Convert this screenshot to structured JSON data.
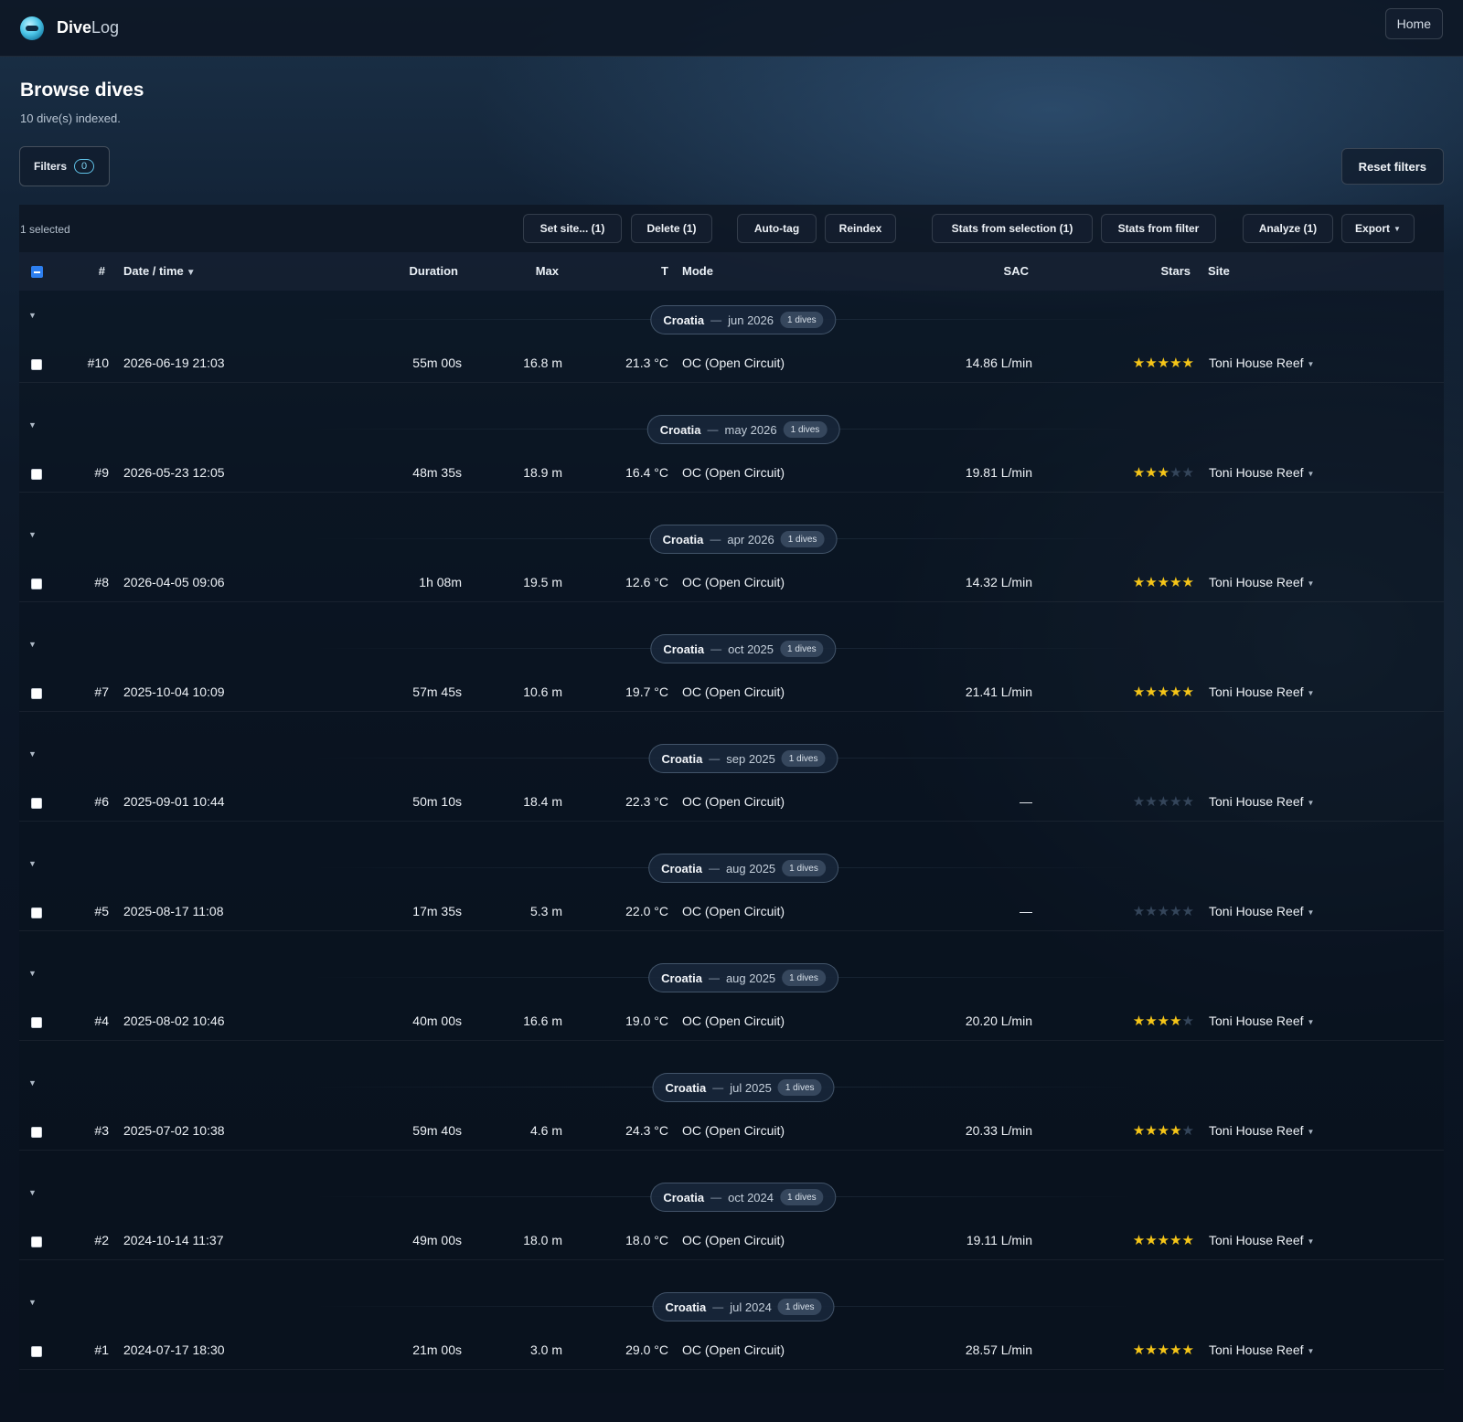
{
  "app": {
    "brand_bold": "Dive",
    "brand_light": "Log",
    "home_label": "Home"
  },
  "page": {
    "title": "Browse dives",
    "subtitle": "10 dive(s) indexed."
  },
  "filters": {
    "label": "Filters",
    "count": "0",
    "reset_label": "Reset filters"
  },
  "actions": {
    "selected_text": "1 selected",
    "set_site": "Set site... (1)",
    "delete": "Delete (1)",
    "auto_tag": "Auto-tag",
    "reindex": "Reindex",
    "stats_selection": "Stats from selection (1)",
    "stats_filter": "Stats from filter",
    "analyze": "Analyze (1)",
    "export": "Export"
  },
  "columns": {
    "num": "#",
    "date": "Date / time",
    "duration": "Duration",
    "max": "Max",
    "temp": "T",
    "mode": "Mode",
    "sac": "SAC",
    "stars": "Stars",
    "site": "Site"
  },
  "colors": {
    "accent": "#2d7ff0",
    "star_on": "#f5c518",
    "star_off": "#34455a",
    "background": "#0b1524"
  },
  "groups": [
    {
      "country": "Croatia",
      "sep": "—",
      "month": "jun 2026",
      "count": "1 dives",
      "dive": {
        "num": "#10",
        "date": "2026-06-19 21:03",
        "duration": "55m 00s",
        "max": "16.8 m",
        "temp": "21.3 °C",
        "mode": "OC (Open Circuit)",
        "sac": "14.86 L/min",
        "stars": 5,
        "site": "Toni House Reef"
      }
    },
    {
      "country": "Croatia",
      "sep": "—",
      "month": "may 2026",
      "count": "1 dives",
      "dive": {
        "num": "#9",
        "date": "2026-05-23 12:05",
        "duration": "48m 35s",
        "max": "18.9 m",
        "temp": "16.4 °C",
        "mode": "OC (Open Circuit)",
        "sac": "19.81 L/min",
        "stars": 3,
        "site": "Toni House Reef"
      }
    },
    {
      "country": "Croatia",
      "sep": "—",
      "month": "apr 2026",
      "count": "1 dives",
      "dive": {
        "num": "#8",
        "date": "2026-04-05 09:06",
        "duration": "1h 08m",
        "max": "19.5 m",
        "temp": "12.6 °C",
        "mode": "OC (Open Circuit)",
        "sac": "14.32 L/min",
        "stars": 5,
        "site": "Toni House Reef"
      }
    },
    {
      "country": "Croatia",
      "sep": "—",
      "month": "oct 2025",
      "count": "1 dives",
      "dive": {
        "num": "#7",
        "date": "2025-10-04 10:09",
        "duration": "57m 45s",
        "max": "10.6 m",
        "temp": "19.7 °C",
        "mode": "OC (Open Circuit)",
        "sac": "21.41 L/min",
        "stars": 5,
        "site": "Toni House Reef"
      }
    },
    {
      "country": "Croatia",
      "sep": "—",
      "month": "sep 2025",
      "count": "1 dives",
      "dive": {
        "num": "#6",
        "date": "2025-09-01 10:44",
        "duration": "50m 10s",
        "max": "18.4 m",
        "temp": "22.3 °C",
        "mode": "OC (Open Circuit)",
        "sac": "—",
        "stars": 0,
        "site": "Toni House Reef"
      }
    },
    {
      "country": "Croatia",
      "sep": "—",
      "month": "aug 2025",
      "count": "1 dives",
      "dive": {
        "num": "#5",
        "date": "2025-08-17 11:08",
        "duration": "17m 35s",
        "max": "5.3 m",
        "temp": "22.0 °C",
        "mode": "OC (Open Circuit)",
        "sac": "—",
        "stars": 0,
        "site": "Toni House Reef"
      }
    },
    {
      "country": "Croatia",
      "sep": "—",
      "month": "aug 2025",
      "count": "1 dives",
      "dive": {
        "num": "#4",
        "date": "2025-08-02 10:46",
        "duration": "40m 00s",
        "max": "16.6 m",
        "temp": "19.0 °C",
        "mode": "OC (Open Circuit)",
        "sac": "20.20 L/min",
        "stars": 4,
        "site": "Toni House Reef"
      }
    },
    {
      "country": "Croatia",
      "sep": "—",
      "month": "jul 2025",
      "count": "1 dives",
      "dive": {
        "num": "#3",
        "date": "2025-07-02 10:38",
        "duration": "59m 40s",
        "max": "4.6 m",
        "temp": "24.3 °C",
        "mode": "OC (Open Circuit)",
        "sac": "20.33 L/min",
        "stars": 4,
        "site": "Toni House Reef"
      }
    },
    {
      "country": "Croatia",
      "sep": "—",
      "month": "oct 2024",
      "count": "1 dives",
      "dive": {
        "num": "#2",
        "date": "2024-10-14 11:37",
        "duration": "49m 00s",
        "max": "18.0 m",
        "temp": "18.0 °C",
        "mode": "OC (Open Circuit)",
        "sac": "19.11 L/min",
        "stars": 5,
        "site": "Toni House Reef"
      }
    },
    {
      "country": "Croatia",
      "sep": "—",
      "month": "jul 2024",
      "count": "1 dives",
      "dive": {
        "num": "#1",
        "date": "2024-07-17 18:30",
        "duration": "21m 00s",
        "max": "3.0 m",
        "temp": "29.0 °C",
        "mode": "OC (Open Circuit)",
        "sac": "28.57 L/min",
        "stars": 5,
        "site": "Toni House Reef"
      }
    }
  ]
}
